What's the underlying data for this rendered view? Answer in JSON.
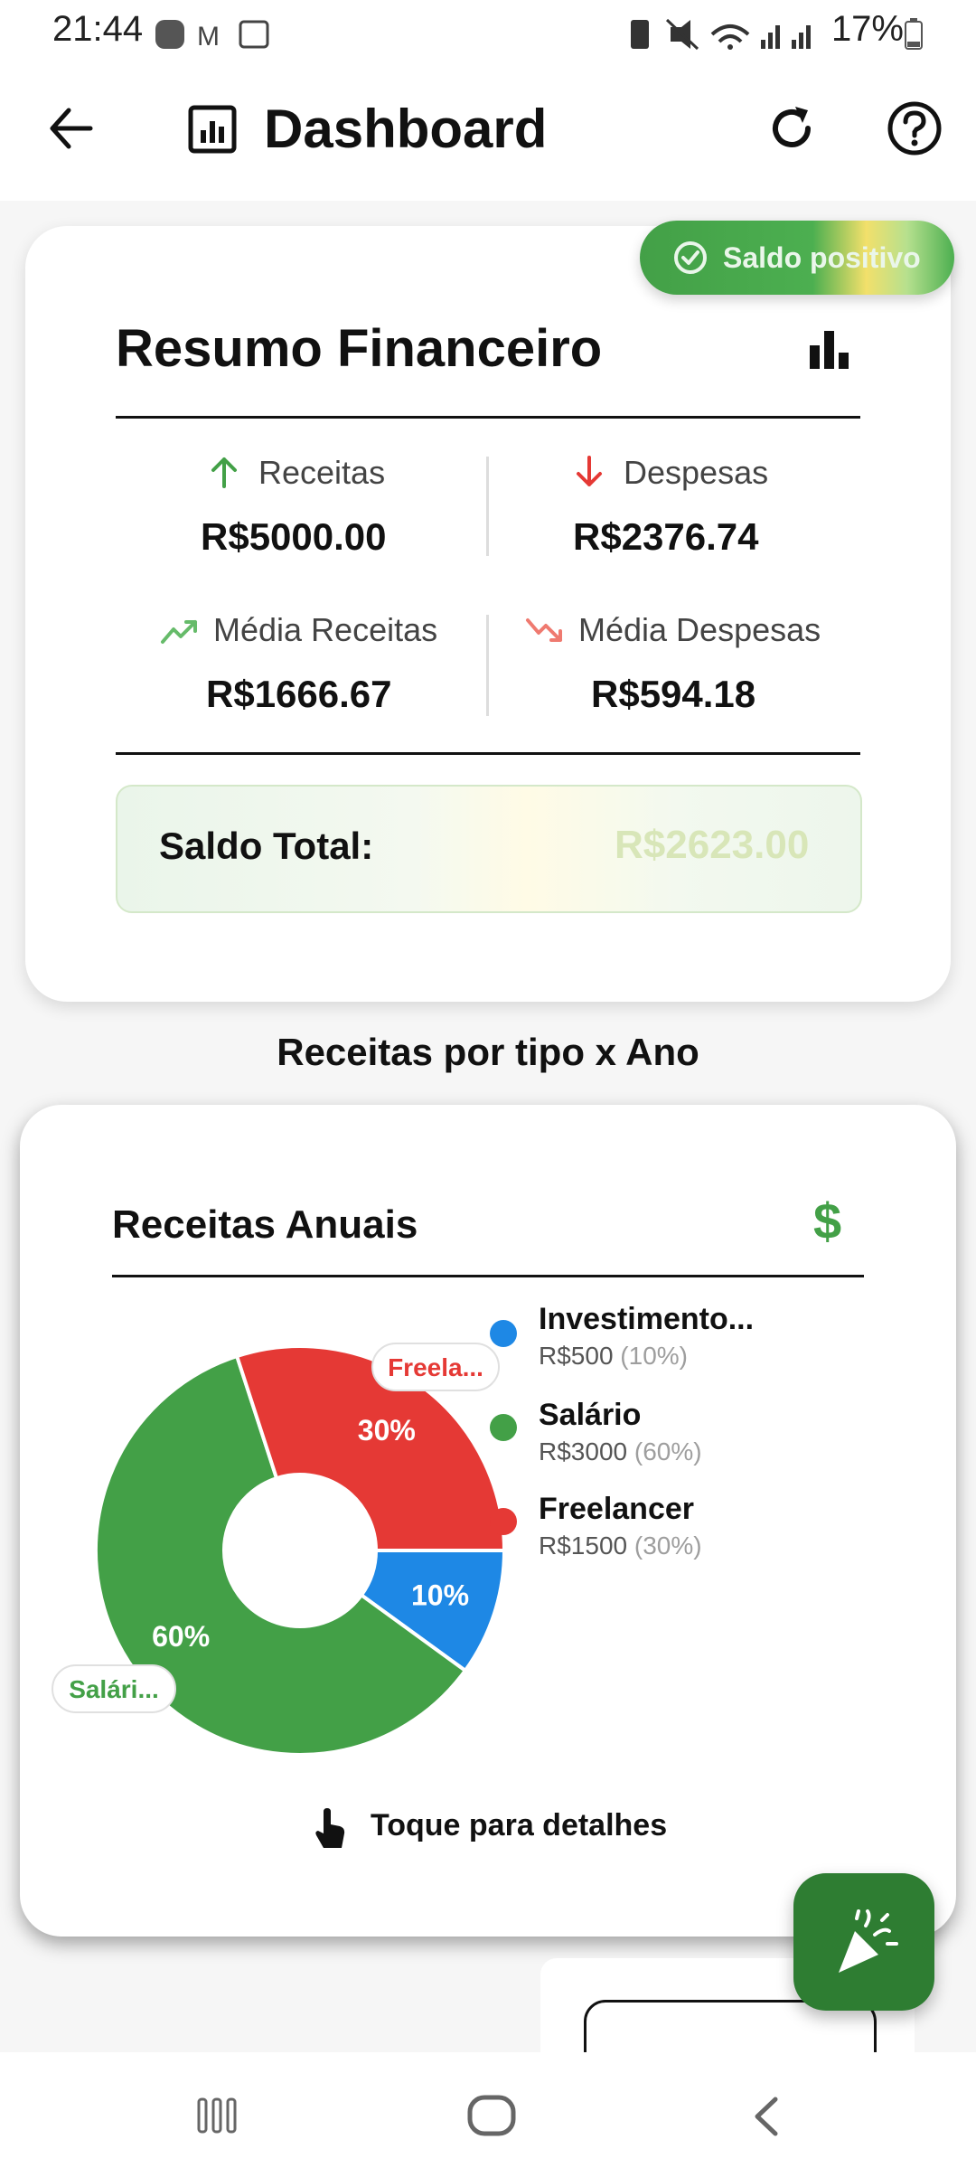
{
  "status_bar": {
    "time": "21:44",
    "battery": "17%"
  },
  "appbar": {
    "title": "Dashboard"
  },
  "summary": {
    "badge": "Saldo positivo",
    "title": "Resumo Financeiro",
    "receitas_label": "Receitas",
    "receitas_value": "R$5000.00",
    "despesas_label": "Despesas",
    "despesas_value": "R$2376.74",
    "media_receitas_label": "Média Receitas",
    "media_receitas_value": "R$1666.67",
    "media_despesas_label": "Média Despesas",
    "media_despesas_value": "R$594.18",
    "saldo_label": "Saldo Total:",
    "saldo_value": "R$2623.00"
  },
  "section_title": "Receitas por tipo x Ano",
  "chart_card": {
    "title": "Receitas Anuais",
    "currency_icon": "$",
    "hint": "Toque para detalhes"
  },
  "colors": {
    "green": "#43a047",
    "red": "#e53935",
    "blue": "#1e88e5"
  },
  "chart_data": {
    "type": "pie",
    "title": "Receitas Anuais",
    "series": [
      {
        "name": "Investimento...",
        "value": 500,
        "value_label": "R$500",
        "percent_label": "(10%)",
        "slice_label": "10%",
        "color": "#1e88e5"
      },
      {
        "name": "Salário",
        "value": 3000,
        "value_label": "R$3000",
        "percent_label": "(60%)",
        "slice_label": "60%",
        "color": "#43a047",
        "callout": "Salári..."
      },
      {
        "name": "Freelancer",
        "value": 1500,
        "value_label": "R$1500",
        "percent_label": "(30%)",
        "slice_label": "30%",
        "color": "#e53935",
        "callout": "Freela..."
      }
    ]
  }
}
